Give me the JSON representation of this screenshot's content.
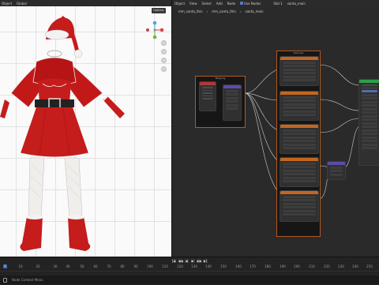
{
  "viewport": {
    "menu_object": "Object",
    "menu_global": "Global",
    "options_label": "Options"
  },
  "node_editor": {
    "menu_object": "Object",
    "menu_view": "View",
    "menu_select": "Select",
    "menu_add": "Add",
    "menu_node": "Node",
    "use_nodes_label": "Use Nodes",
    "slot_label": "Slot 1",
    "material_name": "santa_main",
    "breadcrumbs": [
      "mm_santa_thin",
      "mm_santa_thin",
      "santa_main"
    ],
    "frame_labels": [
      "Mapping",
      "Textures"
    ]
  },
  "timeline": {
    "current_frame": "1",
    "ticks": [
      "10",
      "20",
      "30",
      "40",
      "50",
      "60",
      "70",
      "80",
      "90",
      "100",
      "110",
      "120",
      "130",
      "140",
      "150",
      "160",
      "170",
      "180",
      "190",
      "200",
      "210",
      "220",
      "230",
      "240",
      "250"
    ],
    "controls": [
      "|◀",
      "◀◀",
      "◀",
      "▶",
      "▶▶",
      "▶|"
    ]
  },
  "status": {
    "hint": "Node Context Menu"
  },
  "colors": {
    "frame_border": "#b05a22",
    "texture_header": "#c5661f",
    "shader_header": "#2e9f4a",
    "mix_header": "#5b4ca8",
    "santa_red": "#c51c1c"
  }
}
